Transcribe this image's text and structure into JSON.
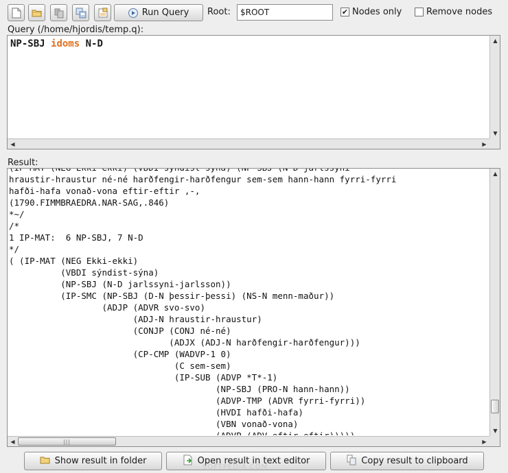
{
  "toolbar": {
    "icons": [
      "new-file-icon",
      "open-folder-icon",
      "copy-icon",
      "save-icon",
      "save-as-icon"
    ],
    "run_label": "Run Query",
    "root_label": "Root:",
    "root_value": "$ROOT",
    "nodes_only_label": "Nodes only",
    "nodes_only_checked": true,
    "remove_nodes_label": "Remove nodes",
    "remove_nodes_checked": false
  },
  "query": {
    "label": "Query (/home/hjordis/temp.q):",
    "tokens": [
      {
        "text": "NP-SBJ "
      },
      {
        "text": "idoms",
        "keyword": true
      },
      {
        "text": " N-D"
      }
    ]
  },
  "result": {
    "label": "Result:",
    "lines": [
      "(IP-MAT (NEG Ekki-ekki) (VBDI sýndist-sýna) (NP-SBJ (N-D jarlssyni",
      "hraustir-hraustur né-né harðfengir-harðfengur sem-sem hann-hann fyrri-fyrri",
      "hafði-hafa vonað-vona eftir-eftir ,-,",
      "(1790.FIMMBRAEDRA.NAR-SAG,.846)",
      "*~/",
      "/*",
      "1 IP-MAT:  6 NP-SBJ, 7 N-D",
      "*/",
      "( (IP-MAT (NEG Ekki-ekki)",
      "          (VBDI sýndist-sýna)",
      "          (NP-SBJ (N-D jarlssyni-jarlsson))",
      "          (IP-SMC (NP-SBJ (D-N þessir-þessi) (NS-N menn-maður))",
      "                  (ADJP (ADVR svo-svo)",
      "                        (ADJ-N hraustir-hraustur)",
      "                        (CONJP (CONJ né-né)",
      "                               (ADJX (ADJ-N harðfengir-harðfengur)))",
      "                        (CP-CMP (WADVP-1 0)",
      "                                (C sem-sem)",
      "                                (IP-SUB (ADVP *T*-1)",
      "                                        (NP-SBJ (PRO-N hann-hann))",
      "                                        (ADVP-TMP (ADVR fyrri-fyrri))",
      "                                        (HVDI hafði-hafa)",
      "                                        (VBN vonað-vona)",
      "                                        (ADVP (ADV eftir-eftir)))))",
      "          (, ,-,)"
    ]
  },
  "buttons": {
    "show_folder": "Show result in folder",
    "open_editor": "Open result in text editor",
    "copy_clipboard": "Copy result to clipboard"
  },
  "watermark": "SOFTPEDIA.COM",
  "colors": {
    "keyword": "#e0701f",
    "background": "#eeeeee"
  }
}
